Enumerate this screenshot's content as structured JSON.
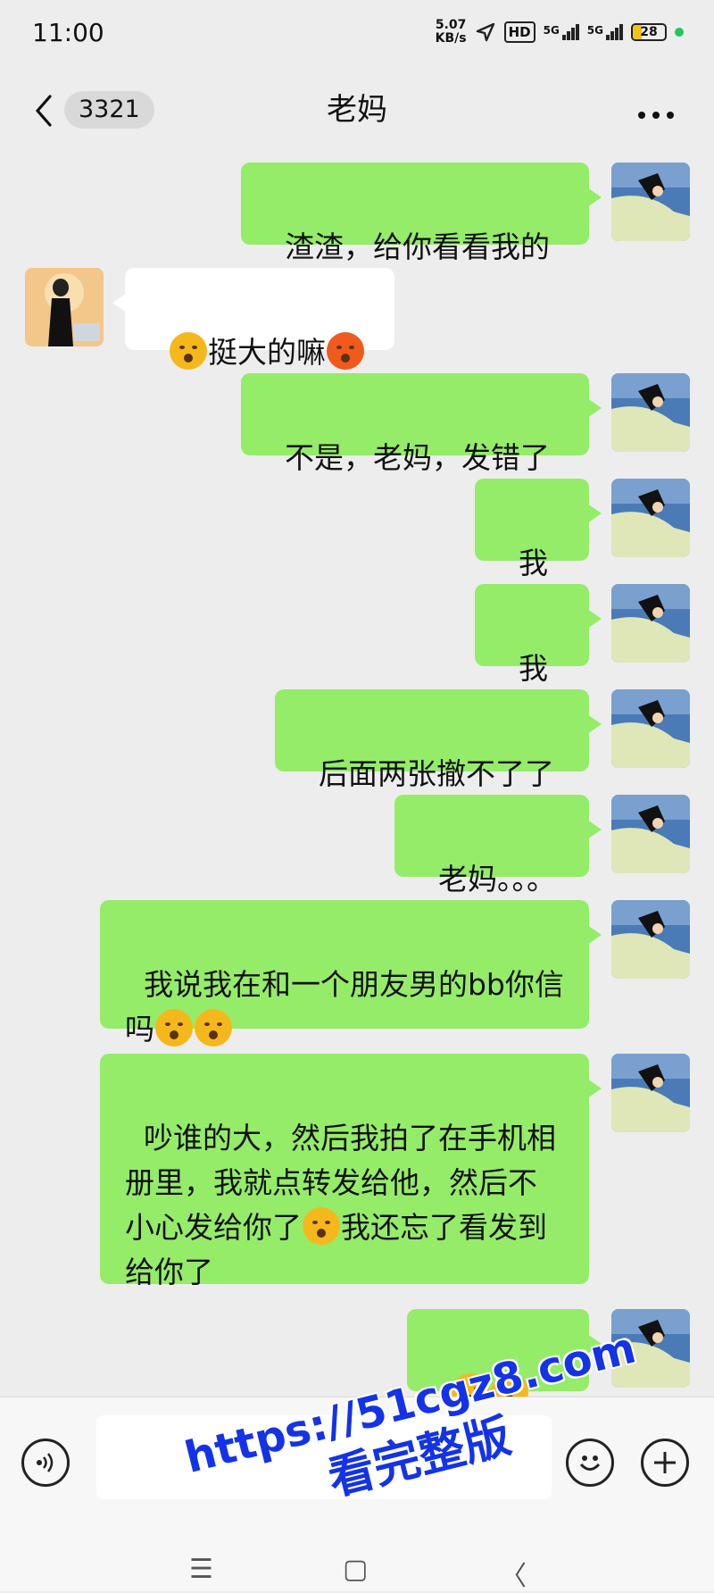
{
  "status_bar": {
    "time": "11:00",
    "net_speed_value": "5.07",
    "net_speed_unit": "KB/s",
    "hd_label": "HD",
    "signal1_label": "5G",
    "signal2_label": "5G",
    "battery_level": "28"
  },
  "header": {
    "back_icon": "chevron-left-icon",
    "unread_count": "3321",
    "title": "老妈",
    "more_icon": "more-dots-icon"
  },
  "messages": [
    {
      "side": "right",
      "text": "渣渣，给你看看我的"
    },
    {
      "side": "left",
      "text": "挺大的嘛",
      "emojis": [
        "thinking-face",
        "sweat-face"
      ]
    },
    {
      "side": "right",
      "text": "不是，老妈，发错了"
    },
    {
      "side": "right",
      "text": "我靠"
    },
    {
      "side": "right",
      "text": "我靠"
    },
    {
      "side": "right",
      "text": "后面两张撤不了了"
    },
    {
      "side": "right",
      "text": "老妈。。。"
    },
    {
      "side": "right",
      "text": "我说我在和一个朋友男的bb你信吗",
      "emojis": [
        "kissing-face",
        "kissing-face"
      ]
    },
    {
      "side": "right",
      "text_1": "吵谁的大，然后我拍了在手机相册里，我就点转发给他，然后不小心发给你了",
      "text_2": "我还忘了看发到给你了",
      "emojis": [
        "kissing-face"
      ]
    },
    {
      "side": "right",
      "text": "",
      "emojis": [
        "tears-of-joy-face",
        "kissing-face",
        "kissing-face"
      ]
    }
  ],
  "bottom_bar": {
    "voice_icon": "voice-icon",
    "input_placeholder": "",
    "emoji_icon": "smiley-icon",
    "plus_icon": "plus-icon"
  },
  "system_nav": {
    "menu_icon": "☰",
    "home_icon": "▢",
    "back_icon": "〈"
  },
  "watermark": {
    "line1": "https://51cgz8.com",
    "line2": "看完整版"
  }
}
